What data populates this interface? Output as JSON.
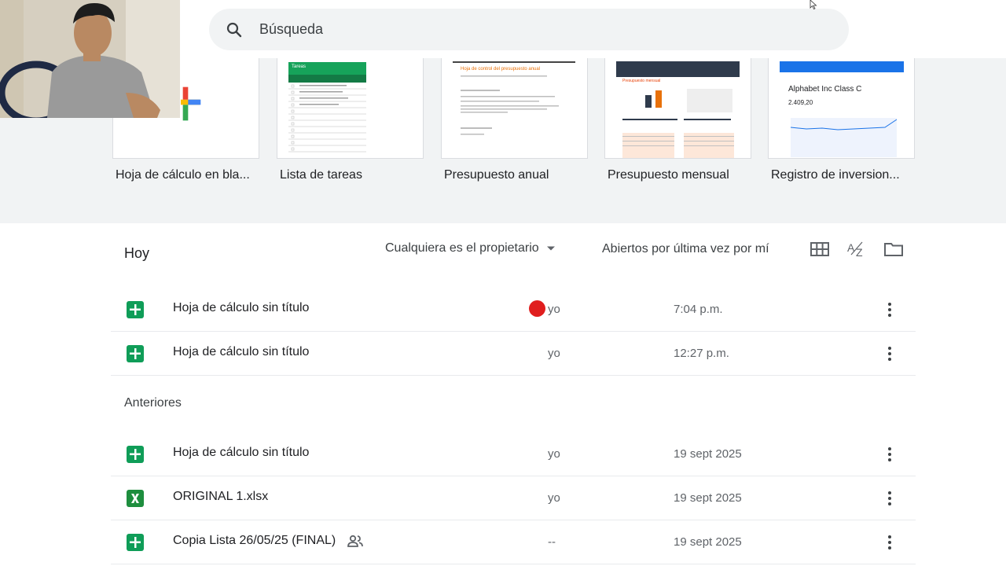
{
  "search": {
    "placeholder": "Búsqueda"
  },
  "templates": [
    {
      "label": "Hoja de cálculo en bla..."
    },
    {
      "label": "Lista de tareas",
      "thumb_title": "Tareas"
    },
    {
      "label": "Presupuesto anual",
      "thumb_title": "Hoja de control del presupuesto anual"
    },
    {
      "label": "Presupuesto mensual",
      "thumb_title": "Presupuesto mensual"
    },
    {
      "label": "Registro de inversion...",
      "thumb_title": "Alphabet Inc Class C",
      "thumb_value": "2.409,20"
    }
  ],
  "filters": {
    "section_today": "Hoy",
    "owner_filter": "Cualquiera es el propietario",
    "sort_label": "Abiertos por última vez por mí"
  },
  "sections": {
    "previous": "Anteriores"
  },
  "files_today": [
    {
      "name": "Hoja de cálculo sin título",
      "owner": "yo",
      "date": "7:04 p.m.",
      "type": "sheets"
    },
    {
      "name": "Hoja de cálculo sin título",
      "owner": "yo",
      "date": "12:27 p.m.",
      "type": "sheets"
    }
  ],
  "files_previous": [
    {
      "name": "Hoja de cálculo sin título",
      "owner": "yo",
      "date": "19 sept 2025",
      "type": "sheets"
    },
    {
      "name": "ORIGINAL 1.xlsx",
      "owner": "yo",
      "date": "19 sept 2025",
      "type": "excel"
    },
    {
      "name": "Copia Lista 26/05/25 (FINAL)",
      "owner": "--",
      "date": "19 sept 2025",
      "type": "sheets",
      "shared": true
    }
  ],
  "colors": {
    "sheets_green": "#0f9d58",
    "excel_green": "#1e8e3e",
    "recording_dot": "#e01e1e"
  },
  "icons": [
    "search-icon",
    "grid-view-icon",
    "sort-az-icon",
    "folder-icon",
    "more-vert-icon",
    "shared-people-icon",
    "sheets-icon",
    "excel-icon",
    "dropdown-arrow-icon"
  ]
}
